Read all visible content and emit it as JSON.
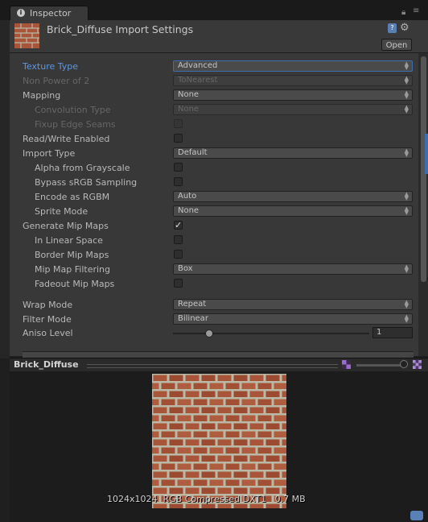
{
  "window": {
    "tab_label": "Inspector",
    "title": "Brick_Diffuse Import Settings",
    "open_label": "Open"
  },
  "settings": [
    {
      "label": "Texture Type",
      "kind": "dropdown",
      "value": "Advanced",
      "indent": false,
      "dim": false,
      "selected": true
    },
    {
      "label": "Non Power of 2",
      "kind": "dropdown",
      "value": "ToNearest",
      "indent": false,
      "dim": true
    },
    {
      "label": "Mapping",
      "kind": "dropdown",
      "value": "None",
      "indent": false,
      "dim": false
    },
    {
      "label": "Convolution Type",
      "kind": "dropdown",
      "value": "None",
      "indent": true,
      "dim": true
    },
    {
      "label": "Fixup Edge Seams",
      "kind": "checkbox",
      "checked": false,
      "indent": true,
      "dim": true
    },
    {
      "label": "Read/Write Enabled",
      "kind": "checkbox",
      "checked": false,
      "indent": false,
      "dim": false
    },
    {
      "label": "Import Type",
      "kind": "dropdown",
      "value": "Default",
      "indent": false,
      "dim": false
    },
    {
      "label": "Alpha from Grayscale",
      "kind": "checkbox",
      "checked": false,
      "indent": true,
      "dim": false
    },
    {
      "label": "Bypass sRGB Sampling",
      "kind": "checkbox",
      "checked": false,
      "indent": true,
      "dim": false
    },
    {
      "label": "Encode as RGBM",
      "kind": "dropdown",
      "value": "Auto",
      "indent": true,
      "dim": false
    },
    {
      "label": "Sprite Mode",
      "kind": "dropdown",
      "value": "None",
      "indent": true,
      "dim": false
    },
    {
      "label": "Generate Mip Maps",
      "kind": "checkbox",
      "checked": true,
      "indent": false,
      "dim": false
    },
    {
      "label": "In Linear Space",
      "kind": "checkbox",
      "checked": false,
      "indent": true,
      "dim": false
    },
    {
      "label": "Border Mip Maps",
      "kind": "checkbox",
      "checked": false,
      "indent": true,
      "dim": false
    },
    {
      "label": "Mip Map Filtering",
      "kind": "dropdown",
      "value": "Box",
      "indent": true,
      "dim": false
    },
    {
      "label": "Fadeout Mip Maps",
      "kind": "checkbox",
      "checked": false,
      "indent": true,
      "dim": false
    },
    {
      "label": "Wrap Mode",
      "kind": "dropdown",
      "value": "Repeat",
      "indent": false,
      "dim": false
    },
    {
      "label": "Filter Mode",
      "kind": "dropdown",
      "value": "Bilinear",
      "indent": false,
      "dim": false
    }
  ],
  "aniso": {
    "label": "Aniso Level",
    "value": "1",
    "level": 1,
    "min": 0,
    "max": 9
  },
  "preview": {
    "name": "Brick_Diffuse",
    "info": "1024x1024  RGB Compressed DXT1   0.7 MB"
  },
  "colors": {
    "accent": "#5d96e2",
    "brick": "#a8553a",
    "mortar": "#b9b9a6"
  }
}
